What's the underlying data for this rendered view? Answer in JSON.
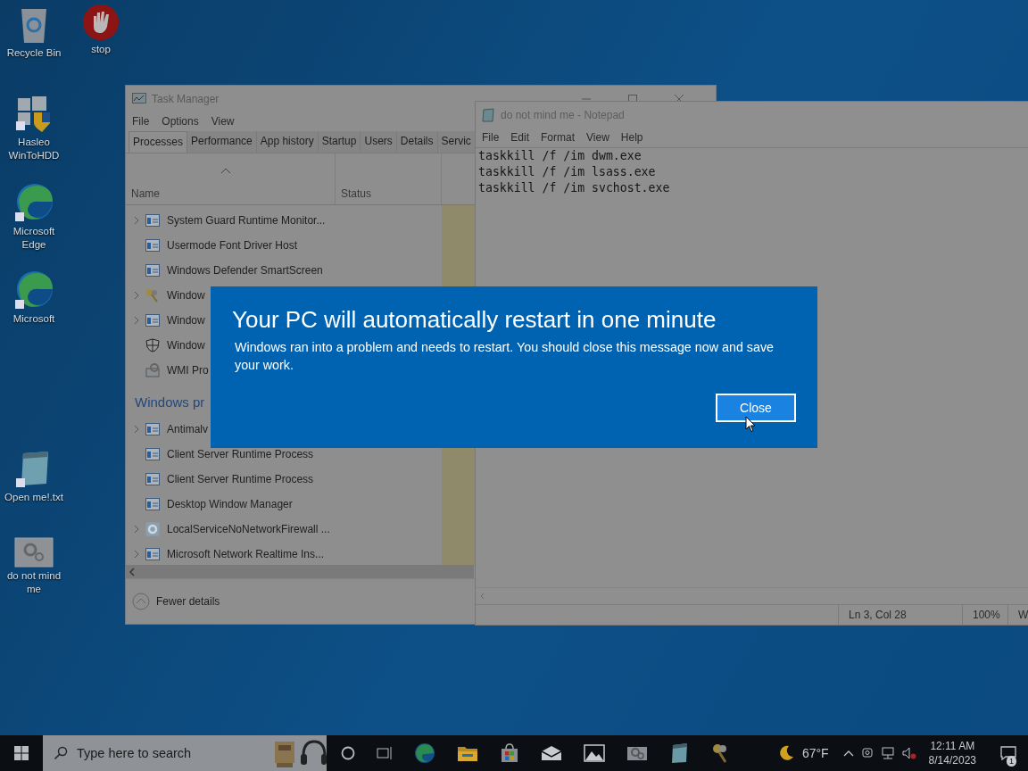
{
  "desktop_icons": [
    {
      "label": "Recycle Bin",
      "kind": "recycle"
    },
    {
      "label": "stop",
      "kind": "stop"
    },
    {
      "label": "Hasleo\nWinToHDD",
      "kind": "installer"
    },
    {
      "label": "Microsoft\nEdge",
      "kind": "edge"
    },
    {
      "label": "Microsoft",
      "kind": "edge"
    },
    {
      "label": "Open me!.txt",
      "kind": "notepad"
    },
    {
      "label": "do not mind\nme",
      "kind": "gears"
    }
  ],
  "task_manager": {
    "title": "Task Manager",
    "menu": [
      "File",
      "Options",
      "View"
    ],
    "tabs": [
      {
        "label": "Processes",
        "selected": true
      },
      {
        "label": "Performance",
        "selected": false
      },
      {
        "label": "App history",
        "selected": false
      },
      {
        "label": "Startup",
        "selected": false
      },
      {
        "label": "Users",
        "selected": false
      },
      {
        "label": "Details",
        "selected": false
      },
      {
        "label": "Servic",
        "selected": false
      }
    ],
    "columns": [
      "Name",
      "Status"
    ],
    "rows": [
      {
        "kind": "process",
        "name": "System Guard Runtime Monitor...",
        "expandable": true
      },
      {
        "kind": "process",
        "name": "Usermode Font Driver Host",
        "expandable": false
      },
      {
        "kind": "process",
        "name": "Windows Defender SmartScreen",
        "expandable": false
      },
      {
        "kind": "process",
        "name": "Window",
        "expandable": true
      },
      {
        "kind": "process",
        "name": "Window",
        "expandable": true
      },
      {
        "kind": "process",
        "name": "Window",
        "expandable": false
      },
      {
        "kind": "process",
        "name": "WMI Pro",
        "expandable": false
      },
      {
        "kind": "section",
        "name": "Windows pr"
      },
      {
        "kind": "process",
        "name": "Antimalv",
        "expandable": true
      },
      {
        "kind": "process",
        "name": "Client Server Runtime Process",
        "expandable": false
      },
      {
        "kind": "process",
        "name": "Client Server Runtime Process",
        "expandable": false
      },
      {
        "kind": "process",
        "name": "Desktop Window Manager",
        "expandable": false
      },
      {
        "kind": "process",
        "name": "LocalServiceNoNetworkFirewall ...",
        "expandable": true
      },
      {
        "kind": "process",
        "name": "Microsoft Network Realtime Ins...",
        "expandable": true
      }
    ],
    "footer": "Fewer details"
  },
  "notepad": {
    "title": "do not mind me - Notepad",
    "menu": [
      "File",
      "Edit",
      "Format",
      "View",
      "Help"
    ],
    "lines": [
      "taskkill /f /im dwm.exe",
      "taskkill /f /im lsass.exe",
      "taskkill /f /im svchost.exe"
    ],
    "status": [
      "Ln 3, Col 28",
      "100%",
      "W"
    ]
  },
  "dialog": {
    "title": "Your PC will automatically restart in one minute",
    "message": "Windows ran into a problem and needs to restart. You should close this message now and save your work.",
    "button": "Close"
  },
  "taskbar": {
    "search": {
      "placeholder": "Type here to search"
    },
    "weather": "67°F",
    "time": "12:11 AM",
    "date": "8/14/2023",
    "notifications": "1"
  }
}
